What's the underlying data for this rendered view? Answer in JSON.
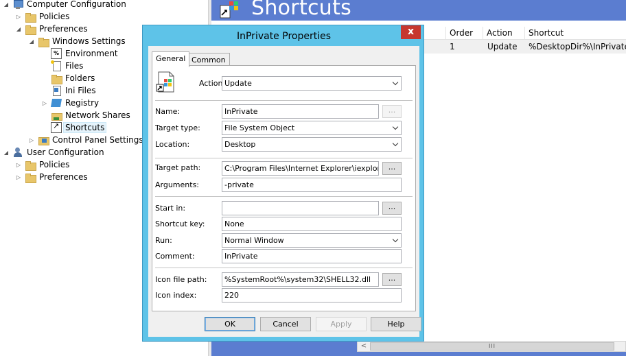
{
  "tree": {
    "computer_config": "Computer Configuration",
    "policies": "Policies",
    "preferences": "Preferences",
    "windows_settings": "Windows Settings",
    "environment": "Environment",
    "files": "Files",
    "folders": "Folders",
    "ini_files": "Ini Files",
    "registry": "Registry",
    "network_shares": "Network Shares",
    "shortcuts": "Shortcuts",
    "control_panel_settings": "Control Panel Settings",
    "user_config": "User Configuration",
    "user_policies": "Policies",
    "user_preferences": "Preferences",
    "env_icon_glyph": "%"
  },
  "right_pane": {
    "header_title": "Shortcuts",
    "columns": {
      "order": "Order",
      "action": "Action",
      "shortcut": "Shortcut"
    },
    "rows": [
      {
        "order": "1",
        "action": "Update",
        "shortcut": "%DesktopDir%\\InPrivate"
      }
    ],
    "scroll_thumb_grip": "III"
  },
  "dialog": {
    "title": "InPrivate Properties",
    "close_glyph": "x",
    "tabs": {
      "general": "General",
      "common": "Common"
    },
    "fields": {
      "action_label": "Action:",
      "action_value": "Update",
      "name_label": "Name:",
      "name_value": "InPrivate",
      "target_type_label": "Target type:",
      "target_type_value": "File System Object",
      "location_label": "Location:",
      "location_value": "Desktop",
      "target_path_label": "Target path:",
      "target_path_value": "C:\\Program Files\\Internet Explorer\\iexplore.exe",
      "arguments_label": "Arguments:",
      "arguments_value": "-private",
      "start_in_label": "Start in:",
      "start_in_value": "",
      "shortcut_key_label": "Shortcut key:",
      "shortcut_key_value": "None",
      "run_label": "Run:",
      "run_value": "Normal Window",
      "comment_label": "Comment:",
      "comment_value": "InPrivate",
      "icon_file_path_label": "Icon file path:",
      "icon_file_path_value": "%SystemRoot%\\system32\\SHELL32.dll",
      "icon_index_label": "Icon index:",
      "icon_index_value": "220",
      "browse_glyph": "..."
    },
    "buttons": {
      "ok": "OK",
      "cancel": "Cancel",
      "apply": "Apply",
      "help": "Help"
    }
  },
  "colors": {
    "accent_band": "#5b7dd0",
    "dialog_frame": "#5ec3e8",
    "close_button": "#c7372f",
    "selection": "#e5f3fb"
  }
}
